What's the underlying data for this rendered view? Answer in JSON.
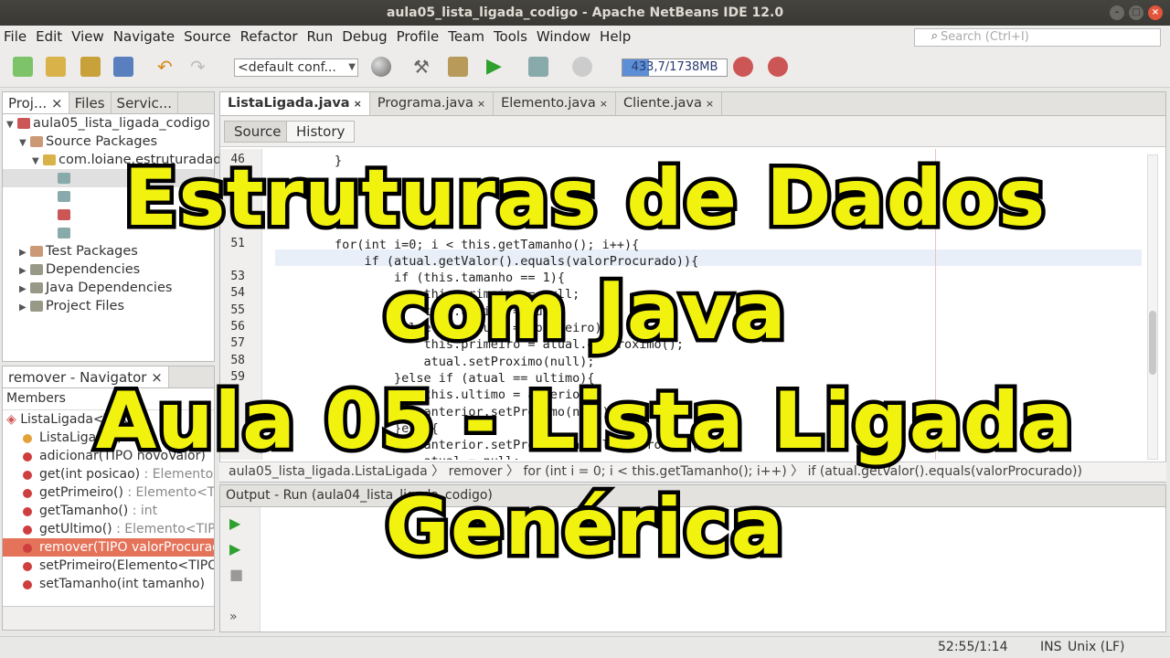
{
  "window": {
    "title": "aula05_lista_ligada_codigo - Apache NetBeans IDE 12.0"
  },
  "menu": [
    "File",
    "Edit",
    "View",
    "Navigate",
    "Source",
    "Refactor",
    "Run",
    "Debug",
    "Profile",
    "Team",
    "Tools",
    "Window",
    "Help"
  ],
  "search": {
    "placeholder": "Search (Ctrl+I)"
  },
  "toolbar": {
    "config": "<default conf...",
    "memory": "433,7/1738MB",
    "memory_fraction": 0.25
  },
  "projects": {
    "tabs": [
      "Proj...",
      "Files",
      "Servic..."
    ],
    "tree": [
      {
        "label": "aula05_lista_ligada_codigo"
      },
      {
        "label": "Source Packages"
      },
      {
        "label": "com.loiane.estruturadados.lista_ligada"
      },
      {
        "label": "Test Packages"
      },
      {
        "label": "Dependencies"
      },
      {
        "label": "Java Dependencies"
      },
      {
        "label": "Project Files"
      }
    ]
  },
  "navigator": {
    "title": "remover - Navigator",
    "filter": "Members",
    "root": "ListaLigada<TIPO>",
    "items": [
      {
        "name": "ListaLigada()",
        "type": ""
      },
      {
        "name": "adicionar(TIPO novoValor)",
        "type": ""
      },
      {
        "name": "get(int posicao)",
        "type": " : Elemento<TIPO>"
      },
      {
        "name": "getPrimeiro()",
        "type": " : Elemento<TIPO>"
      },
      {
        "name": "getTamanho()",
        "type": " : int"
      },
      {
        "name": "getUltimo()",
        "type": " : Elemento<TIPO>"
      },
      {
        "name": "remover(TIPO valorProcurado)",
        "type": ""
      },
      {
        "name": "setPrimeiro(Elemento<TIPO> primeiro)",
        "type": ""
      },
      {
        "name": "setTamanho(int tamanho)",
        "type": ""
      }
    ]
  },
  "editor": {
    "tabs": [
      "ListaLigada.java",
      "Programa.java",
      "Elemento.java",
      "Cliente.java"
    ],
    "source_label": "Source",
    "history_label": "History",
    "line_numbers": [
      "46",
      "",
      "",
      "",
      "",
      "51",
      "",
      "53",
      "54",
      "55",
      "56",
      "57",
      "58",
      "59",
      "",
      "",
      ""
    ],
    "code": [
      "        }",
      "",
      "",
      "",
      "",
      "        for(int i=0; i < this.getTamanho(); i++){",
      "            if (atual.getValor().equals(valorProcurado)){",
      "                if (this.tamanho == 1){",
      "                    this.primeiro = null;",
      "                    this.ultimo = null;",
      "                }else if (atual == primeiro){",
      "                    this.primeiro = atual.getProximo();",
      "                    atual.setProximo(null);",
      "                }else if (atual == ultimo){",
      "                    this.ultimo = anterior;",
      "                    anterior.setProximo(null);",
      "                }else{",
      "                    anterior.setProximo(atual.getProximo());",
      "                    atual = null;"
    ],
    "breadcrumb": [
      "aula05_lista_ligada.ListaLigada",
      "remover",
      "for (int i = 0; i < this.getTamanho(); i++)",
      "if (atual.getValor().equals(valorProcurado))"
    ]
  },
  "output": {
    "title": "Output - Run (aula04_lista_ligada_codigo)"
  },
  "status": {
    "position": "52:55/1:14",
    "mode": "INS",
    "eol": "Unix (LF)"
  },
  "overlay": {
    "line1": "Estruturas de Dados",
    "line2": "com Java",
    "line3": "Aula 05 - Lista Ligada",
    "line4": "Genérica"
  },
  "colors": {
    "overlay_text": "#f2f20f",
    "overlay_stroke": "#000000",
    "selection": "#e4735a"
  }
}
